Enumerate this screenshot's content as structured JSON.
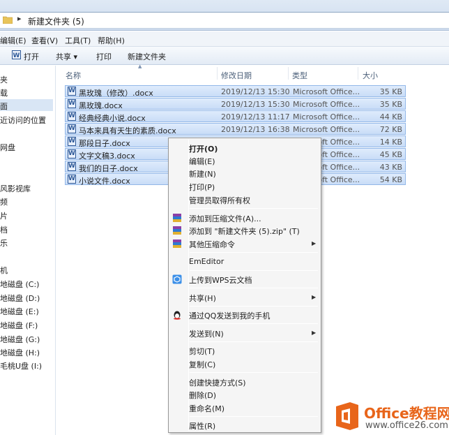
{
  "address": {
    "path": "新建文件夹 (5)"
  },
  "menu": [
    "编辑(E)",
    "查看(V)",
    "工具(T)",
    "帮助(H)"
  ],
  "toolbar": {
    "open": "打开",
    "share": "共享 ▾",
    "print": "打印",
    "new_folder": "新建文件夹"
  },
  "nav": {
    "items": [
      "夹",
      "载",
      "面",
      "近访问的位置",
      "网盘",
      "风影视库",
      "频",
      "片",
      "档",
      "乐",
      "机",
      "地磁盘 (C:)",
      "地磁盘 (D:)",
      "地磁盘 (E:)",
      "地磁盘 (F:)",
      "地磁盘 (G:)",
      "地磁盘 (H:)",
      "毛桃U盘 (I:)"
    ]
  },
  "columns": {
    "name": "名称",
    "date": "修改日期",
    "type": "类型",
    "size": "大小"
  },
  "files": [
    {
      "name": "黑玫瑰（修改）.docx",
      "date": "2019/12/13 15:30",
      "type": "Microsoft Office...",
      "size": "35 KB"
    },
    {
      "name": "黑玫瑰.docx",
      "date": "2019/12/13 15:30",
      "type": "Microsoft Office...",
      "size": "35 KB"
    },
    {
      "name": "经典经典小说.docx",
      "date": "2019/12/13 11:17",
      "type": "Microsoft Office...",
      "size": "44 KB"
    },
    {
      "name": "马本来具有天生的素质.docx",
      "date": "2019/12/13 16:38",
      "type": "Microsoft Office...",
      "size": "72 KB"
    },
    {
      "name": "那段日子.docx",
      "date": "",
      "type": "Microsoft Office...",
      "size": "14 KB"
    },
    {
      "name": "文字文稿3.docx",
      "date": "",
      "type": "Microsoft Office...",
      "size": "45 KB"
    },
    {
      "name": "我们的日子.docx",
      "date": "",
      "type": "Microsoft Office...",
      "size": "43 KB"
    },
    {
      "name": "小说文件.docx",
      "date": "",
      "type": "Microsoft Office...",
      "size": "54 KB"
    }
  ],
  "file_icon_letter": "W",
  "context_menu": {
    "open": "打开(O)",
    "edit": "编辑(E)",
    "new": "新建(N)",
    "print": "打印(P)",
    "take_ownership": "管理员取得所有权",
    "add_archive": "添加到压缩文件(A)...",
    "add_zip": "添加到 \"新建文件夹 (5).zip\" (T)",
    "other_compress": "其他压缩命令",
    "emeditor": "EmEditor",
    "upload_wps": "上传到WPS云文档",
    "share": "共享(H)",
    "send_qq": "通过QQ发送到我的手机",
    "send_to": "发送到(N)",
    "cut": "剪切(T)",
    "copy": "复制(C)",
    "create_shortcut": "创建快捷方式(S)",
    "delete": "删除(D)",
    "rename": "重命名(M)",
    "properties": "属性(R)"
  },
  "watermark": {
    "title": "Office教程网",
    "url": "www.office26.com"
  },
  "colors": {
    "selection_fill": "#cfe2f9",
    "selection_border": "#92b7e8",
    "brand_orange": "#e8651a"
  }
}
